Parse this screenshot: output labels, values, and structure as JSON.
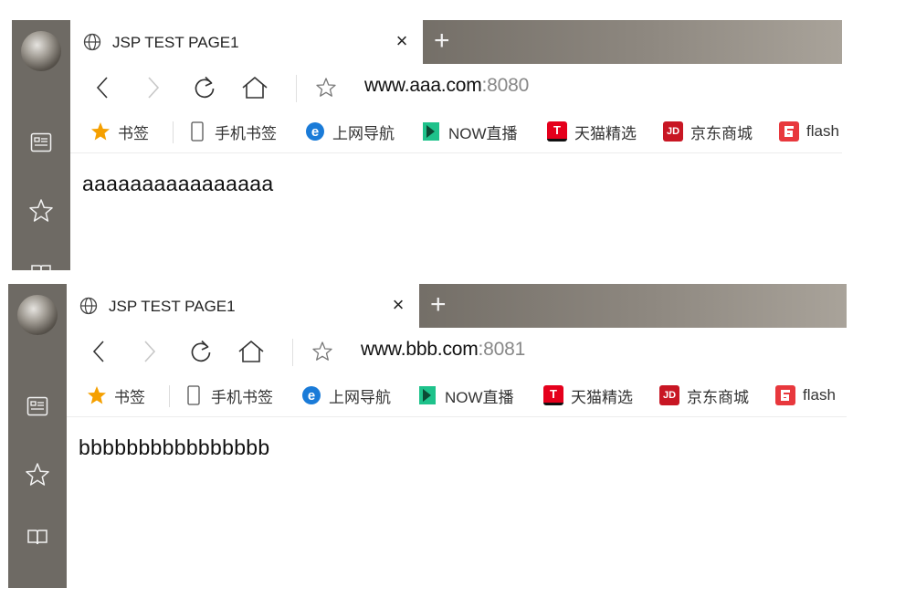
{
  "windows": [
    {
      "tab": {
        "title": "JSP TEST PAGE1",
        "close_glyph": "×",
        "new_tab_glyph": "+"
      },
      "address": {
        "host": "www.aaa.com",
        "port": ":8080"
      },
      "bookmarks": [
        {
          "label": "书签",
          "icon": "star-icon"
        },
        {
          "label": "手机书签",
          "icon": "phone-icon"
        },
        {
          "label": "上网导航",
          "icon": "ie-icon"
        },
        {
          "label": "NOW直播",
          "icon": "now-icon"
        },
        {
          "label": "天猫精选",
          "icon": "tmall-icon"
        },
        {
          "label": "京东商城",
          "icon": "jd-icon"
        },
        {
          "label": "flash",
          "icon": "flash-icon"
        }
      ],
      "page_text": "aaaaaaaaaaaaaaaa"
    },
    {
      "tab": {
        "title": "JSP TEST PAGE1",
        "close_glyph": "×",
        "new_tab_glyph": "+"
      },
      "address": {
        "host": "www.bbb.com",
        "port": ":8081"
      },
      "bookmarks": [
        {
          "label": "书签",
          "icon": "star-icon"
        },
        {
          "label": "手机书签",
          "icon": "phone-icon"
        },
        {
          "label": "上网导航",
          "icon": "ie-icon"
        },
        {
          "label": "NOW直播",
          "icon": "now-icon"
        },
        {
          "label": "天猫精选",
          "icon": "tmall-icon"
        },
        {
          "label": "京东商城",
          "icon": "jd-icon"
        },
        {
          "label": "flash",
          "icon": "flash-icon"
        }
      ],
      "page_text": "bbbbbbbbbbbbbbbb"
    }
  ],
  "icon_badges": {
    "tmall": "T",
    "jd": "JD"
  },
  "colors": {
    "sidebar": "#6e6a64",
    "star": "#f5a000",
    "ie": "#1a7bd8",
    "now": "#1ec28b",
    "tmall": "#e5001c",
    "jd": "#c81623",
    "flash": "#e8383d"
  }
}
